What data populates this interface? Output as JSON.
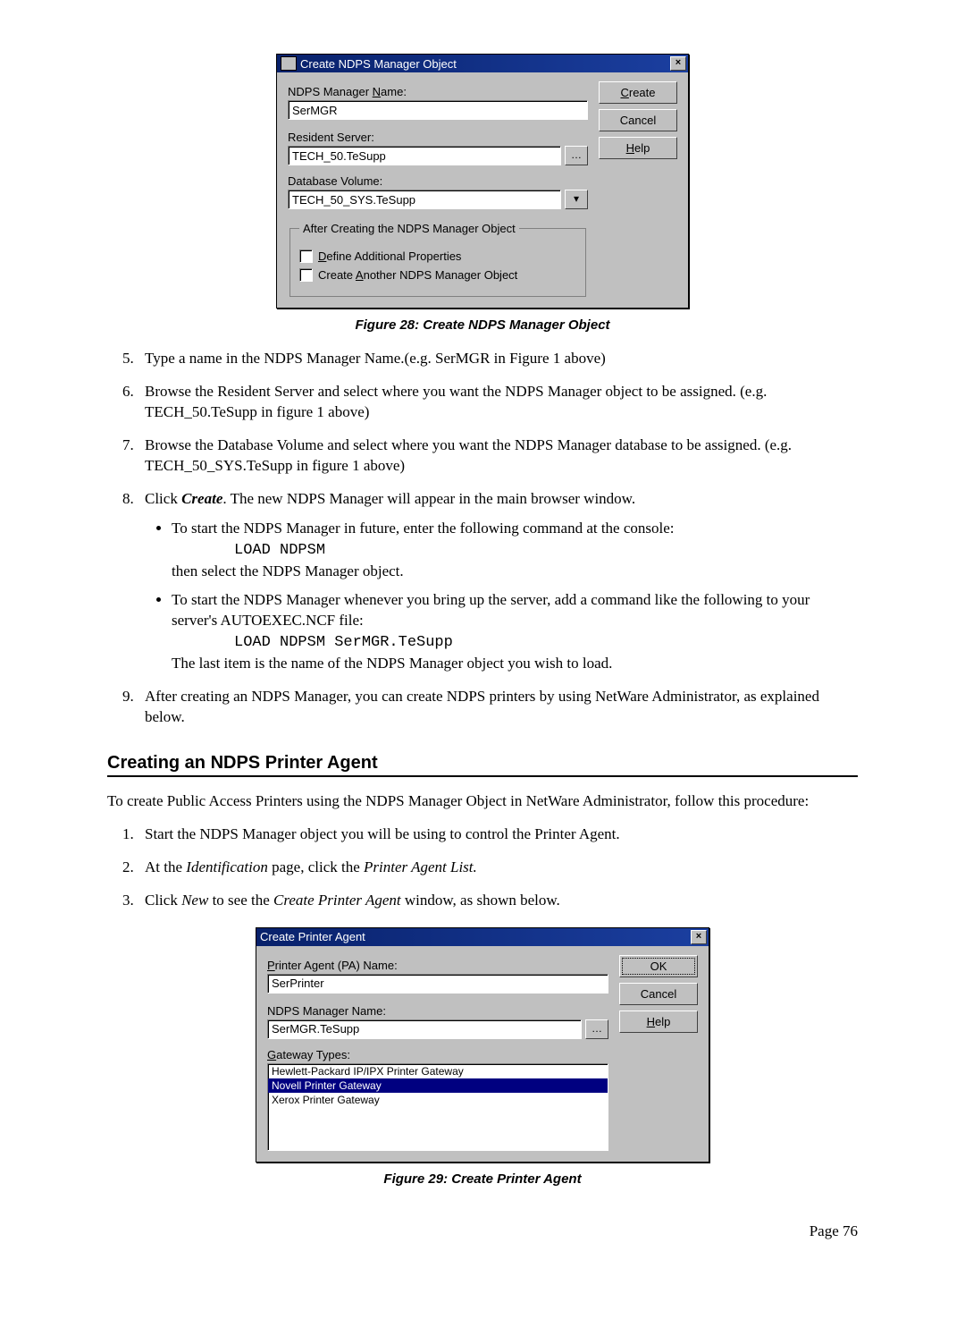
{
  "dialog1": {
    "title": "Create NDPS Manager Object",
    "labels": {
      "name": "NDPS Manager Name:",
      "resident": "Resident Server:",
      "dbvol": "Database Volume:"
    },
    "values": {
      "name": "SerMGR",
      "resident": "TECH_50.TeSupp",
      "dbvol": "TECH_50_SYS.TeSupp"
    },
    "group_legend": "After Creating the NDPS Manager Object",
    "chk1_pre": "D",
    "chk1_rest": "efine Additional Properties",
    "chk2_pre": "Create ",
    "chk2_u": "A",
    "chk2_rest": "nother NDPS Manager Object",
    "buttons": {
      "create_u": "C",
      "create_rest": "reate",
      "cancel": "Cancel",
      "help_u": "H",
      "help_rest": "elp"
    }
  },
  "fig1_caption": "Figure 28: Create NDPS Manager Object",
  "steps_a": {
    "s5": "Type a name in the NDPS Manager Name.(e.g. SerMGR in Figure 1 above)",
    "s6": "Browse the Resident Server and select where you want the NDPS Manager object to be assigned. (e.g.  TECH_50.TeSupp in figure 1 above)",
    "s7": "Browse the Database Volume and select where you want the NDPS Manager database to be assigned. (e.g.  TECH_50_SYS.TeSupp in figure 1 above)",
    "s8_pre": "Click ",
    "s8_bi": "Create",
    "s8_post": ". The new NDPS Manager will appear in the main browser window.",
    "b1a": "To start the NDPS Manager in future, enter the following command at the console:",
    "b1_cmd": "LOAD NDPSM",
    "b1b": "then select the NDPS Manager object.",
    "b2a": "To start the NDPS Manager whenever you bring up the server, add a command like the following to your server's AUTOEXEC.NCF file:",
    "b2_cmd": "LOAD  NDPSM  SerMGR.TeSupp",
    "b2b": "The last item is the name of the NDPS Manager object you wish to load.",
    "s9": "After creating an NDPS Manager, you can create NDPS printers by using NetWare Administrator, as explained below."
  },
  "section2_title": "Creating an NDPS Printer Agent",
  "intro2": "To create Public Access Printers using the NDPS Manager Object in NetWare Administrator, follow this procedure:",
  "steps_b": {
    "s1": "Start the NDPS Manager object you will be using to control the Printer Agent.",
    "s2_pre": "At the ",
    "s2_i1": "Identification",
    "s2_mid": " page, click the ",
    "s2_i2": "Printer Agent List.",
    "s3_pre": "Click ",
    "s3_i1": "New",
    "s3_mid": " to see the ",
    "s3_i2": "Create Printer Agent",
    "s3_post": " window, as shown below."
  },
  "dialog2": {
    "title": "Create Printer Agent",
    "labels": {
      "pa_pre": "P",
      "pa_rest": "rinter Agent (PA) Name:",
      "mgr": "NDPS Manager Name:",
      "gw_pre": "G",
      "gw_rest": "ateway Types:"
    },
    "values": {
      "pa": "SerPrinter",
      "mgr": "SerMGR.TeSupp"
    },
    "options": {
      "o1": "Hewlett-Packard IP/IPX Printer Gateway",
      "o2": "Novell Printer Gateway",
      "o3": "Xerox Printer Gateway"
    },
    "buttons": {
      "ok": "OK",
      "cancel": "Cancel",
      "help_u": "H",
      "help_rest": "elp"
    }
  },
  "fig2_caption": "Figure 29: Create Printer Agent",
  "page_num": "Page 76"
}
